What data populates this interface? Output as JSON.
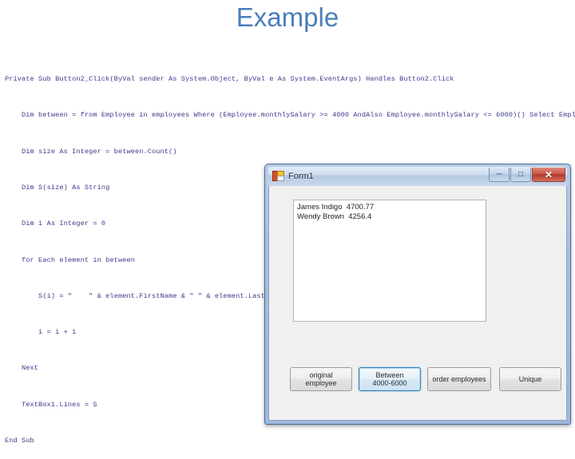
{
  "slide": {
    "title": "Example",
    "title_color": "#4a7ebb"
  },
  "code": {
    "language": "vb-net",
    "lines": [
      "Private Sub Button2_Click(ByVal sender As System.Object, ByVal e As System.EventArgs) Handles Button2.Click",
      "    Dim between = from Employee in employees Where (Employee.monthlySalary >= 4000 AndAlso Employee.monthlySalary <= 6000)() Select Employee",
      "    Dim size As Integer = between.Count()",
      "    Dim S(size) As String",
      "    Dim i As Integer = 0",
      "    for Each element in between",
      "        S(i) = \"    \" & element.FirstName & \" \" & element.LastName & \"    \" & element.monthlySalary",
      "        i = i + 1",
      "    Next",
      "    TextBox1.Lines = S",
      "End Sub"
    ]
  },
  "form_window": {
    "title": "Form1",
    "icon": "vb-form-icon",
    "controls": {
      "minimize_label": "─",
      "maximize_label": "□",
      "close_label": "✕"
    },
    "textbox": {
      "name": "TextBox1",
      "value": "James Indigo  4700.77\nWendy Brown  4256.4",
      "placeholder": ""
    },
    "buttons": [
      {
        "id": "original-employee",
        "label": "original\nemployee",
        "focused": false
      },
      {
        "id": "between-4000-6000",
        "label": "Between\n4000-6000",
        "focused": true
      },
      {
        "id": "order-employees",
        "label": "order employees",
        "focused": false
      },
      {
        "id": "unique",
        "label": "Unique",
        "focused": false
      }
    ]
  }
}
